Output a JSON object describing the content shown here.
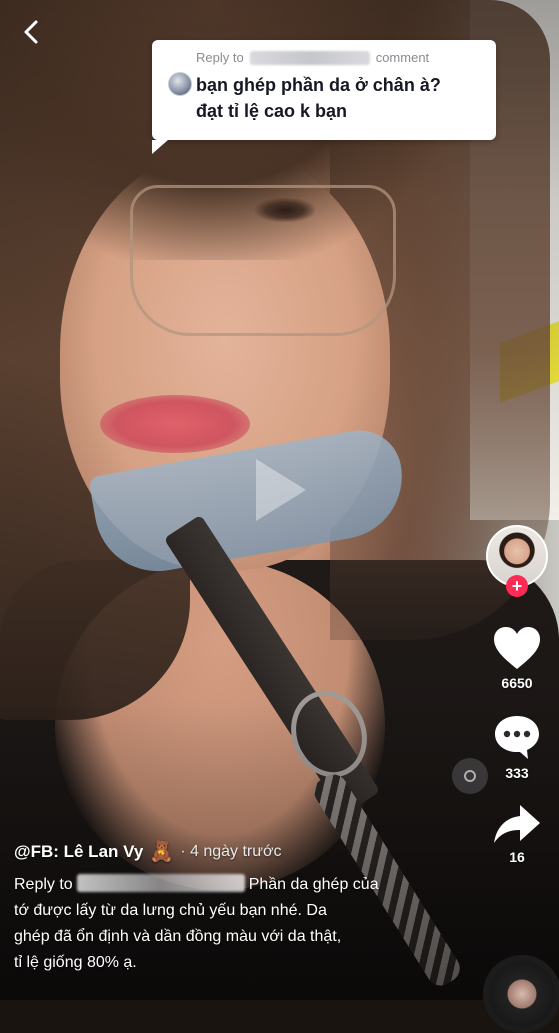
{
  "reply_card": {
    "prefix": "Reply to",
    "suffix": "comment",
    "line1": "bạn ghép phần da ở chân à?",
    "line2": "đạt tỉ lệ cao k bạn"
  },
  "side_rail": {
    "likes": "6650",
    "comments": "333",
    "shares": "16",
    "follow_symbol": "+"
  },
  "caption": {
    "username": "@FB: Lê Lan Vy",
    "emoji": "🧸",
    "time": "· 4 ngày trước",
    "reply_prefix": "Reply to",
    "line1_suffix": "Phần da ghép của",
    "line2": "tớ được lấy từ da lưng chủ yếu bạn nhé. Da",
    "line3": "ghép đã ổn định và dần đồng màu với da thật,",
    "line4": "tỉ lệ giống 80% ạ."
  },
  "icons": {
    "back": "back-chevron-icon",
    "play": "play-icon",
    "like": "heart-icon",
    "comment": "comment-bubble-icon",
    "share": "share-arrow-icon",
    "music": "music-disc-icon"
  }
}
